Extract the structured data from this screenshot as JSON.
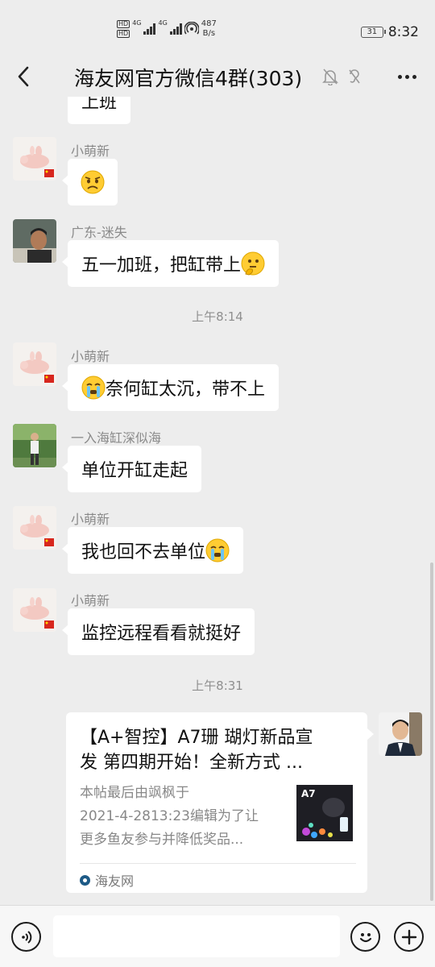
{
  "status_bar": {
    "hd1": "HD",
    "hd2": "HD",
    "net1": "4G",
    "net2": "4G",
    "speed_value": "487",
    "speed_unit": "B/s",
    "battery": "31",
    "time": "8:32"
  },
  "header": {
    "title": "海友网官方微信4群(303)"
  },
  "messages": [
    {
      "type": "cut",
      "text": "上班"
    },
    {
      "sender": "小萌新",
      "avatar": "pig-avatar",
      "text": "",
      "emoji": "worried-face"
    },
    {
      "sender": "广东-迷失",
      "avatar": "man-avatar",
      "text": "五一加班，把缸带上",
      "emoji": "thinking-face"
    },
    {
      "type": "time",
      "text": "上午8:14"
    },
    {
      "sender": "小萌新",
      "avatar": "pig-avatar",
      "text": "奈何缸太沉，带不上",
      "emoji": "crying-face"
    },
    {
      "sender": "一入海缸深似海",
      "avatar": "person-avatar",
      "text": "单位开缸走起"
    },
    {
      "sender": "小萌新",
      "avatar": "pig-avatar",
      "text": "我也回不去单位",
      "emoji": "crying-face"
    },
    {
      "sender": "小萌新",
      "avatar": "pig-avatar",
      "text": "监控远程看看就挺好"
    },
    {
      "type": "time",
      "text": "上午8:31"
    }
  ],
  "link_card": {
    "title_line1": "【A+智控】A7珊 瑚灯新品宣",
    "title_line2": "发 第四期开始！全新方式 ...",
    "desc_line1": "本帖最后由飒枫于",
    "desc_line2": "2021-4-2813:23编辑为了让",
    "desc_line3": "更多鱼友参与并降低奖品...",
    "thumb_label": "A7",
    "source": "海友网"
  },
  "colors": {
    "background": "#ededed",
    "bubble": "#ffffff",
    "muted_text": "#8a8a8a"
  }
}
